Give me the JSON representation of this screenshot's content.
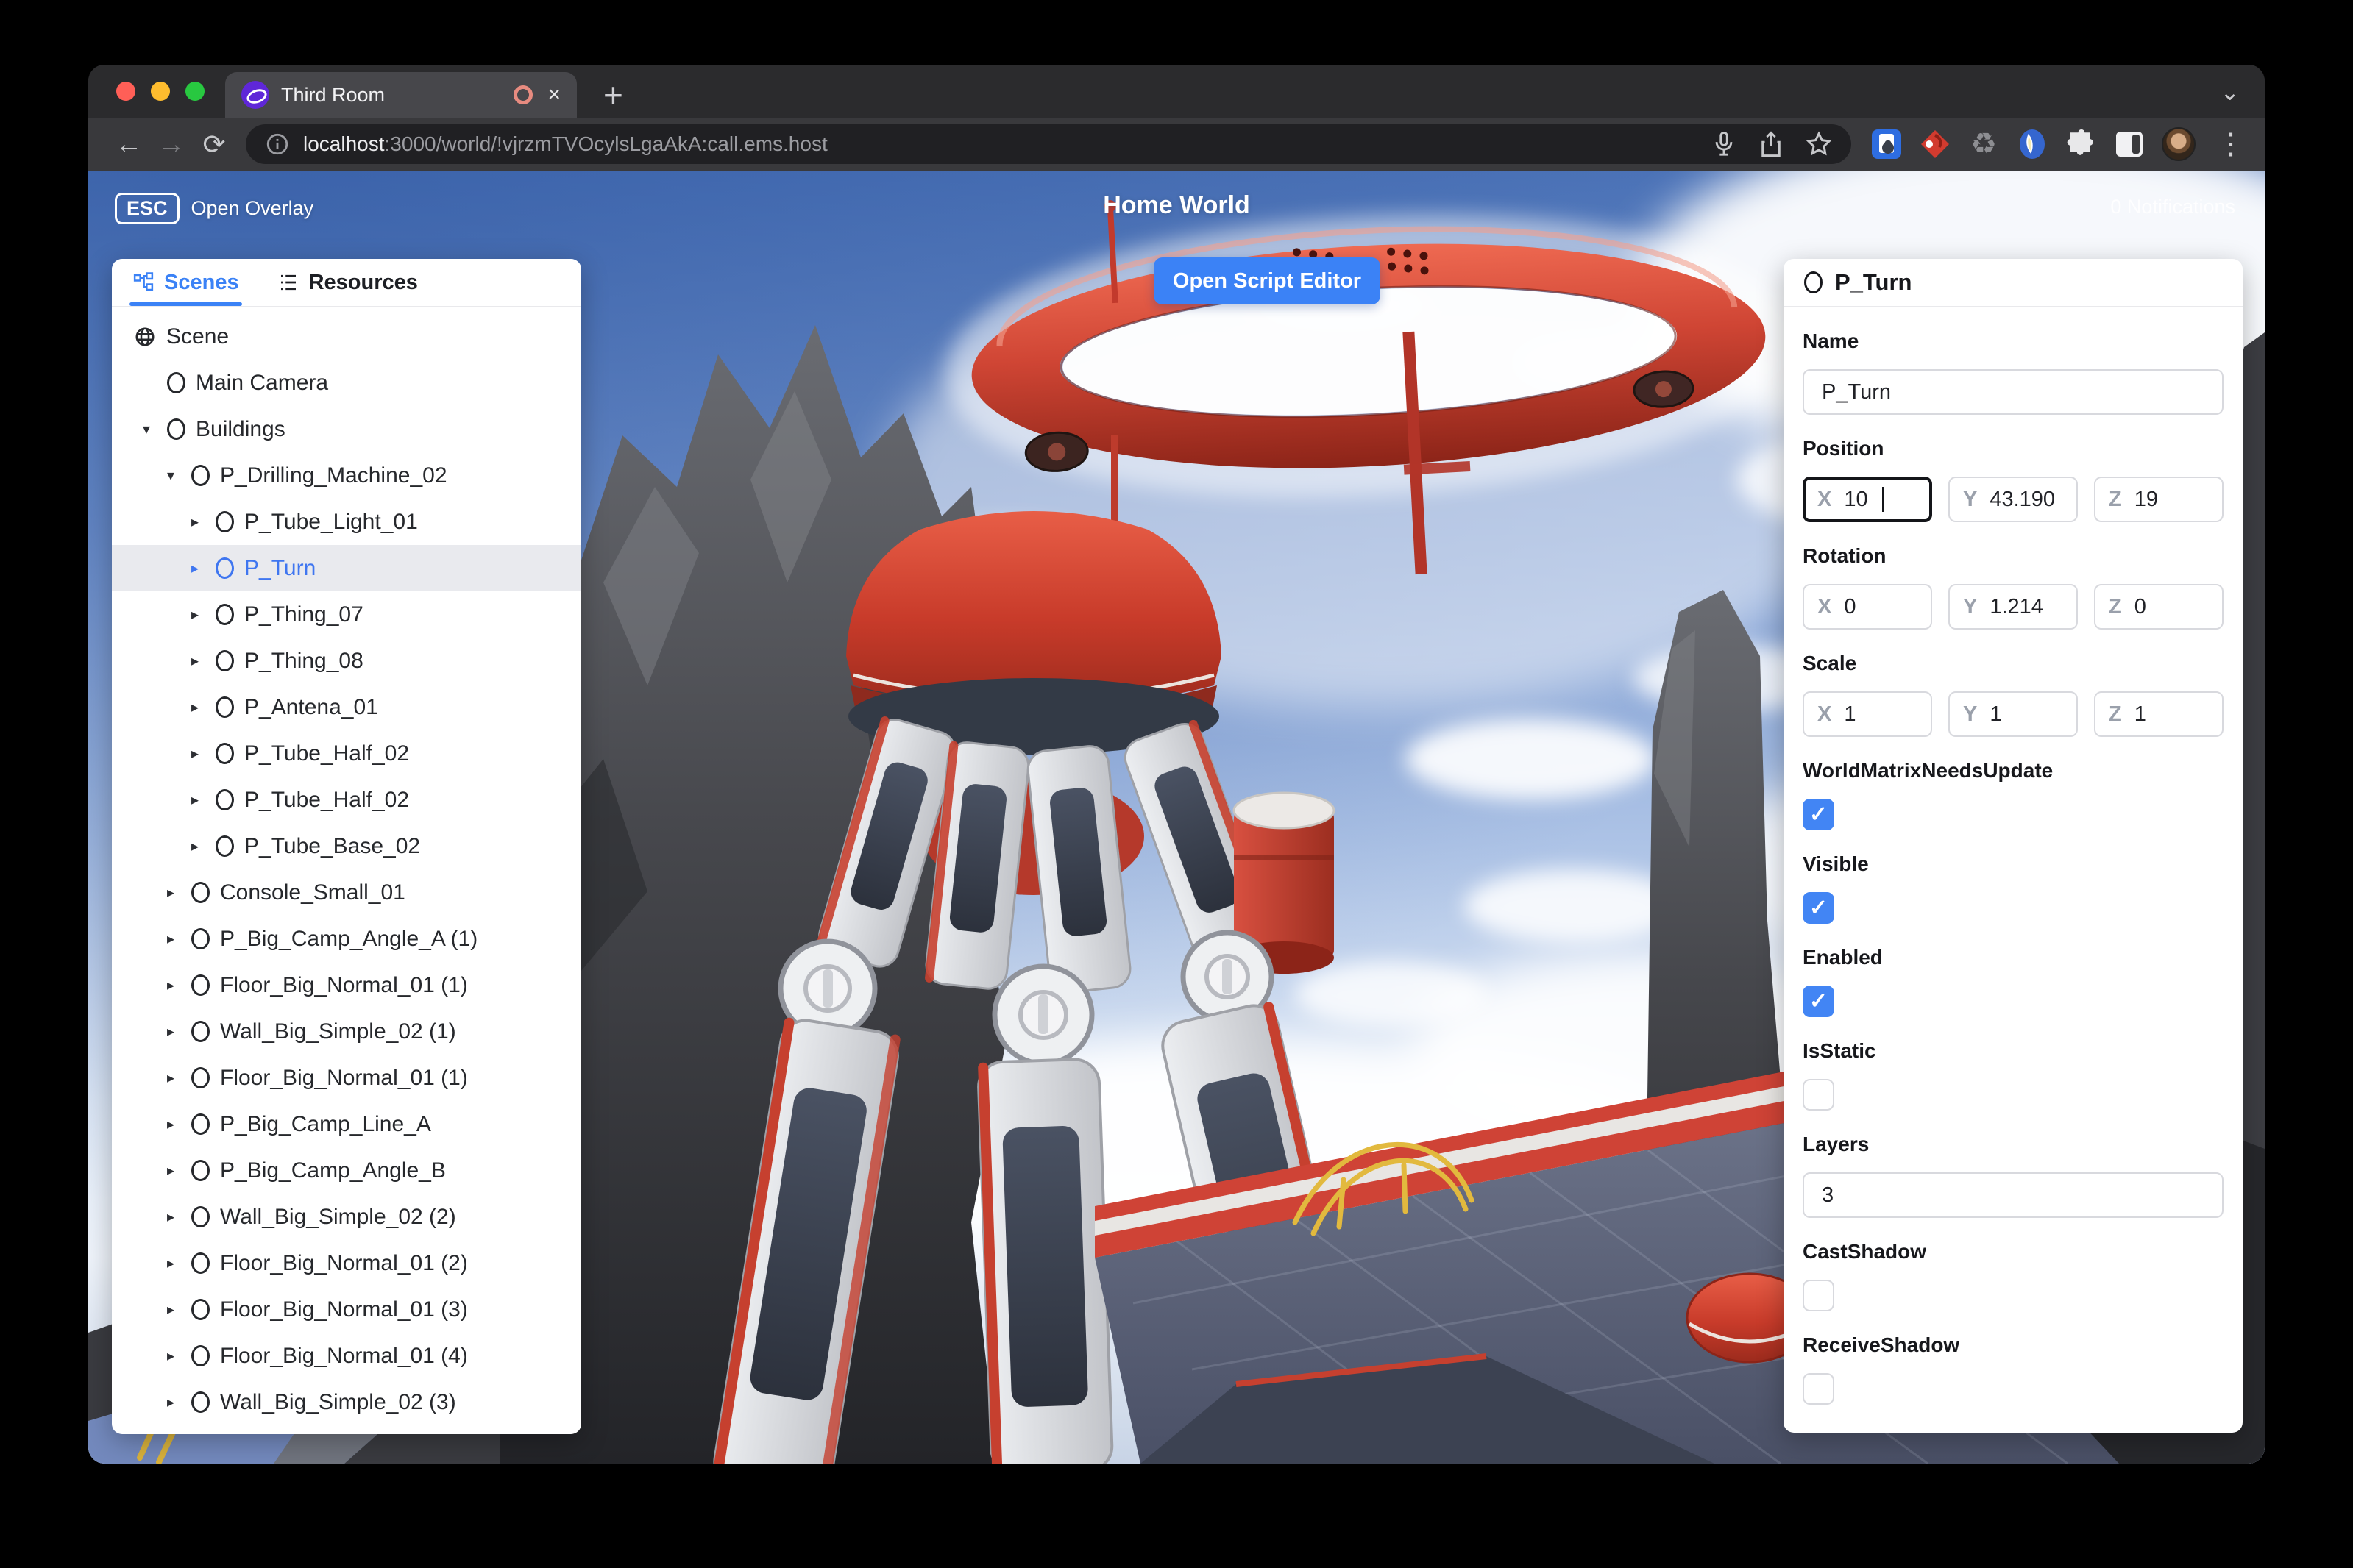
{
  "browser": {
    "tab_title": "Third Room",
    "url_host": "localhost",
    "url_path": ":3000/world/!vjrzmTVOcylsLgaAkA:call.ems.host",
    "new_tab_label": "+",
    "tab_close_label": "×",
    "icons": [
      "back-icon",
      "forward-icon",
      "reload-icon",
      "site-info-icon",
      "mic-icon",
      "share-icon",
      "bookmark-star-icon",
      "password-manager-icon",
      "red-diamond-extension-icon",
      "recycle-extension-icon",
      "blue-circle-extension-icon",
      "extensions-puzzle-icon",
      "side-panel-icon",
      "profile-avatar",
      "menu-icon"
    ]
  },
  "hud": {
    "esc_key": "ESC",
    "open_overlay": "Open Overlay",
    "world_title": "Home World",
    "notifications": "0 Notifications",
    "open_script_editor": "Open Script Editor"
  },
  "left_panel": {
    "tabs": [
      {
        "label": "Scenes",
        "active": true
      },
      {
        "label": "Resources",
        "active": false
      }
    ],
    "tree": [
      {
        "label": "Scene",
        "depth": 0,
        "icon": "globe",
        "caret": "none",
        "selected": false
      },
      {
        "label": "Main Camera",
        "depth": 1,
        "icon": "circle",
        "caret": "none",
        "selected": false
      },
      {
        "label": "Buildings",
        "depth": 1,
        "icon": "circle",
        "caret": "down",
        "selected": false
      },
      {
        "label": "P_Drilling_Machine_02",
        "depth": 2,
        "icon": "circle",
        "caret": "down",
        "selected": false
      },
      {
        "label": "P_Tube_Light_01",
        "depth": 3,
        "icon": "circle",
        "caret": "right",
        "selected": false
      },
      {
        "label": "P_Turn",
        "depth": 3,
        "icon": "circle",
        "caret": "right",
        "selected": true
      },
      {
        "label": "P_Thing_07",
        "depth": 3,
        "icon": "circle",
        "caret": "right",
        "selected": false
      },
      {
        "label": "P_Thing_08",
        "depth": 3,
        "icon": "circle",
        "caret": "right",
        "selected": false
      },
      {
        "label": "P_Antena_01",
        "depth": 3,
        "icon": "circle",
        "caret": "right",
        "selected": false
      },
      {
        "label": "P_Tube_Half_02",
        "depth": 3,
        "icon": "circle",
        "caret": "right",
        "selected": false
      },
      {
        "label": "P_Tube_Half_02",
        "depth": 3,
        "icon": "circle",
        "caret": "right",
        "selected": false
      },
      {
        "label": "P_Tube_Base_02",
        "depth": 3,
        "icon": "circle",
        "caret": "right",
        "selected": false
      },
      {
        "label": "Console_Small_01",
        "depth": 2,
        "icon": "circle",
        "caret": "right",
        "selected": false
      },
      {
        "label": "P_Big_Camp_Angle_A (1)",
        "depth": 2,
        "icon": "circle",
        "caret": "right",
        "selected": false
      },
      {
        "label": "Floor_Big_Normal_01 (1)",
        "depth": 2,
        "icon": "circle",
        "caret": "right",
        "selected": false
      },
      {
        "label": "Wall_Big_Simple_02 (1)",
        "depth": 2,
        "icon": "circle",
        "caret": "right",
        "selected": false
      },
      {
        "label": "Floor_Big_Normal_01 (1)",
        "depth": 2,
        "icon": "circle",
        "caret": "right",
        "selected": false
      },
      {
        "label": "P_Big_Camp_Line_A",
        "depth": 2,
        "icon": "circle",
        "caret": "right",
        "selected": false
      },
      {
        "label": "P_Big_Camp_Angle_B",
        "depth": 2,
        "icon": "circle",
        "caret": "right",
        "selected": false
      },
      {
        "label": "Wall_Big_Simple_02 (2)",
        "depth": 2,
        "icon": "circle",
        "caret": "right",
        "selected": false
      },
      {
        "label": "Floor_Big_Normal_01 (2)",
        "depth": 2,
        "icon": "circle",
        "caret": "right",
        "selected": false
      },
      {
        "label": "Floor_Big_Normal_01 (3)",
        "depth": 2,
        "icon": "circle",
        "caret": "right",
        "selected": false
      },
      {
        "label": "Floor_Big_Normal_01 (4)",
        "depth": 2,
        "icon": "circle",
        "caret": "right",
        "selected": false
      },
      {
        "label": "Wall_Big_Simple_02 (3)",
        "depth": 2,
        "icon": "circle",
        "caret": "right",
        "selected": false
      }
    ]
  },
  "inspector": {
    "title": "P_Turn",
    "fields": [
      {
        "type": "text",
        "label": "Name",
        "value": "P_Turn",
        "name": "name-field"
      },
      {
        "type": "vector",
        "label": "Position",
        "name": "position-field",
        "inputs": [
          {
            "axis": "X",
            "value": "10",
            "focused": true
          },
          {
            "axis": "Y",
            "value": "43.190",
            "focused": false
          },
          {
            "axis": "Z",
            "value": "19",
            "focused": false
          }
        ]
      },
      {
        "type": "vector",
        "label": "Rotation",
        "name": "rotation-field",
        "inputs": [
          {
            "axis": "X",
            "value": "0",
            "focused": false
          },
          {
            "axis": "Y",
            "value": "1.214",
            "focused": false
          },
          {
            "axis": "Z",
            "value": "0",
            "focused": false
          }
        ]
      },
      {
        "type": "vector",
        "label": "Scale",
        "name": "scale-field",
        "inputs": [
          {
            "axis": "X",
            "value": "1",
            "focused": false
          },
          {
            "axis": "Y",
            "value": "1",
            "focused": false
          },
          {
            "axis": "Z",
            "value": "1",
            "focused": false
          }
        ]
      },
      {
        "type": "checkbox",
        "label": "WorldMatrixNeedsUpdate",
        "checked": true,
        "name": "worldmatrixneedsupdate-checkbox"
      },
      {
        "type": "checkbox",
        "label": "Visible",
        "checked": true,
        "name": "visible-checkbox"
      },
      {
        "type": "checkbox",
        "label": "Enabled",
        "checked": true,
        "name": "enabled-checkbox"
      },
      {
        "type": "checkbox",
        "label": "IsStatic",
        "checked": false,
        "name": "isstatic-checkbox"
      },
      {
        "type": "text",
        "label": "Layers",
        "value": "3",
        "name": "layers-field"
      },
      {
        "type": "checkbox",
        "label": "CastShadow",
        "checked": false,
        "name": "castshadow-checkbox"
      },
      {
        "type": "checkbox",
        "label": "ReceiveShadow",
        "checked": false,
        "name": "receiveshadow-checkbox"
      }
    ],
    "check_glyph": "✓"
  },
  "colors": {
    "accent": "#3b82f6",
    "checkbox": "#4285f4",
    "selected_text": "#3f76f0",
    "ring_red": "#c23a2c"
  }
}
